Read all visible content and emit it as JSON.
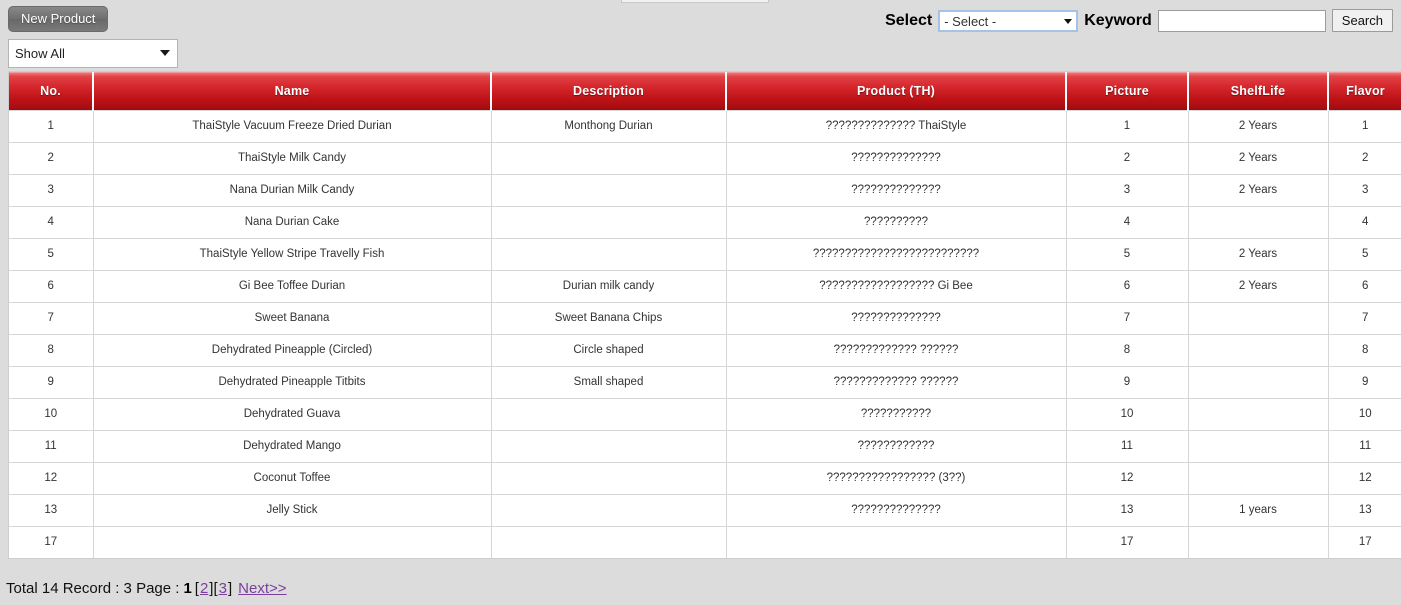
{
  "toolbar": {
    "new_product_label": "New Product",
    "show_all": {
      "selected": "Show All",
      "options": [
        "Show All"
      ]
    }
  },
  "search": {
    "select_label": "Select",
    "select_value": "- Select -",
    "select_options": [
      "- Select -"
    ],
    "keyword_label": "Keyword",
    "keyword_value": "",
    "keyword_placeholder": "",
    "search_button": "Search"
  },
  "table": {
    "columns": [
      {
        "key": "no",
        "label": "No."
      },
      {
        "key": "name",
        "label": "Name"
      },
      {
        "key": "desc",
        "label": "Description"
      },
      {
        "key": "th",
        "label": "Product (TH)"
      },
      {
        "key": "pic",
        "label": "Picture"
      },
      {
        "key": "shelf",
        "label": "ShelfLife"
      },
      {
        "key": "flav",
        "label": "Flavor"
      }
    ],
    "rows": [
      {
        "no": "1",
        "name": "ThaiStyle Vacuum Freeze Dried Durian",
        "desc": "Monthong Durian",
        "th": "?????????????? ThaiStyle",
        "pic": "1",
        "shelf": "2 Years",
        "flav": "1"
      },
      {
        "no": "2",
        "name": "ThaiStyle Milk Candy",
        "desc": "",
        "th": "??????????????",
        "pic": "2",
        "shelf": "2 Years",
        "flav": "2"
      },
      {
        "no": "3",
        "name": "Nana Durian Milk Candy",
        "desc": "",
        "th": "??????????????",
        "pic": "3",
        "shelf": "2 Years",
        "flav": "3"
      },
      {
        "no": "4",
        "name": "Nana Durian Cake",
        "desc": "",
        "th": "??????????",
        "pic": "4",
        "shelf": "",
        "flav": "4"
      },
      {
        "no": "5",
        "name": "ThaiStyle Yellow Stripe Travelly Fish",
        "desc": "",
        "th": "??????????????????????????",
        "pic": "5",
        "shelf": "2 Years",
        "flav": "5"
      },
      {
        "no": "6",
        "name": "Gi Bee Toffee Durian",
        "desc": "Durian milk candy",
        "th": "?????????????????? Gi Bee",
        "pic": "6",
        "shelf": "2 Years",
        "flav": "6"
      },
      {
        "no": "7",
        "name": "Sweet Banana",
        "desc": "Sweet Banana Chips",
        "th": "??????????????",
        "pic": "7",
        "shelf": "",
        "flav": "7"
      },
      {
        "no": "8",
        "name": "Dehydrated Pineapple (Circled)",
        "desc": "Circle shaped",
        "th": "????????????? ??????",
        "pic": "8",
        "shelf": "",
        "flav": "8"
      },
      {
        "no": "9",
        "name": "Dehydrated Pineapple Titbits",
        "desc": "Small shaped",
        "th": "????????????? ??????",
        "pic": "9",
        "shelf": "",
        "flav": "9"
      },
      {
        "no": "10",
        "name": "Dehydrated Guava",
        "desc": "",
        "th": "???????????",
        "pic": "10",
        "shelf": "",
        "flav": "10"
      },
      {
        "no": "11",
        "name": "Dehydrated Mango",
        "desc": "",
        "th": "????????????",
        "pic": "11",
        "shelf": "",
        "flav": "11"
      },
      {
        "no": "12",
        "name": "Coconut Toffee",
        "desc": "",
        "th": "????????????????? (3??)",
        "pic": "12",
        "shelf": "",
        "flav": "12"
      },
      {
        "no": "13",
        "name": "Jelly Stick",
        "desc": "",
        "th": "??????????????",
        "pic": "13",
        "shelf": "1 years",
        "flav": "13"
      },
      {
        "no": "17",
        "name": "",
        "desc": "",
        "th": "",
        "pic": "17",
        "shelf": "",
        "flav": "17"
      }
    ]
  },
  "footer": {
    "total_text": "Total 14 Record : 3 Page :",
    "current_page": "1",
    "open_bracket": "[",
    "close_bracket": "]",
    "pages": [
      "2",
      "3"
    ],
    "next_label": "Next>>"
  },
  "colors": {
    "header_red_top": "#e14145",
    "header_red_bottom": "#a60d11",
    "page_background": "#dcdcdc",
    "link_purple": "#7a3f9d",
    "button_gray": "#777777"
  }
}
